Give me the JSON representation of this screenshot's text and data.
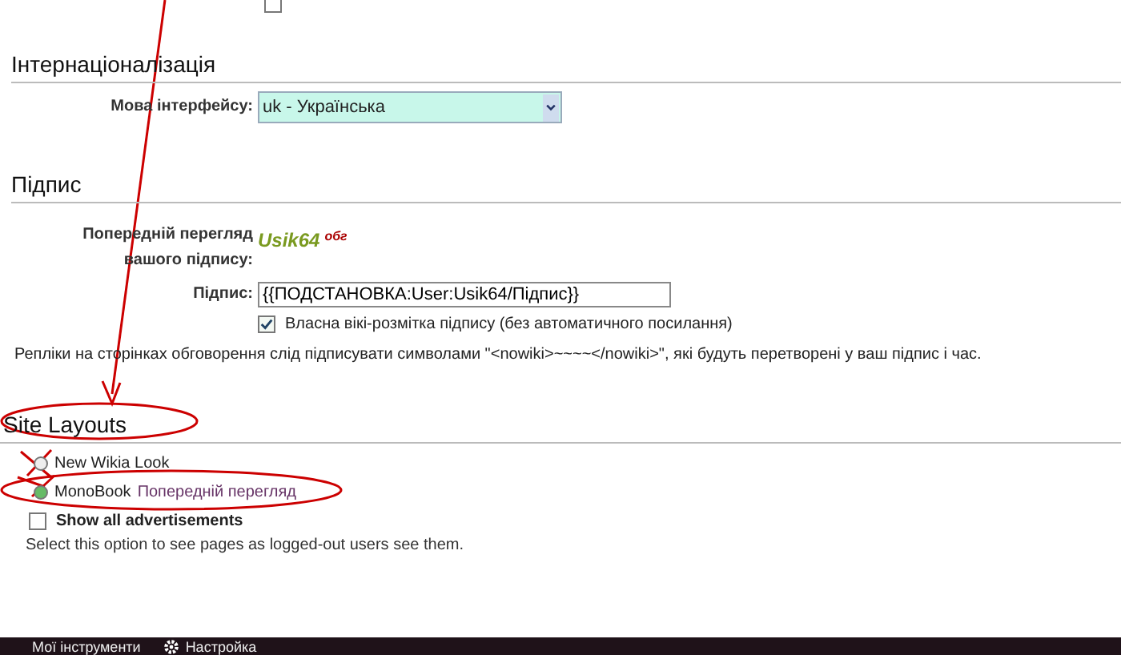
{
  "top_option": {
    "checked": false
  },
  "i18n": {
    "heading": "Інтернаціоналізація",
    "label": "Мова інтерфейсу:",
    "value": "uk - Українська"
  },
  "signature": {
    "heading": "Підпис",
    "preview_label": "Попередній перегляд вашого підпису:",
    "preview_name": "Usik64",
    "preview_talk": "обг",
    "field_label": "Підпис:",
    "field_value": "{{ПОДСТАНОВКА:User:Usik64/Підпис}}",
    "raw_label": "Власна вікі-розмітка підпису (без автоматичного посилання)",
    "raw_checked": true,
    "note": "Репліки на сторінках обговорення слід підписувати символами \"<nowiki>~~~~</nowiki>\", які будуть перетворені у ваш підпис і час."
  },
  "layouts": {
    "heading": "Site Layouts",
    "options": [
      {
        "label": "New Wikia Look",
        "selected": false
      },
      {
        "label": "MonoBook",
        "link": "Попередній перегляд",
        "selected": true
      }
    ],
    "ads_label": "Show all advertisements",
    "ads_checked": false,
    "ads_note": "Select this option to see pages as logged-out users see them."
  },
  "toolbar": {
    "items": [
      "Мої інструменти",
      "Настройка"
    ]
  }
}
